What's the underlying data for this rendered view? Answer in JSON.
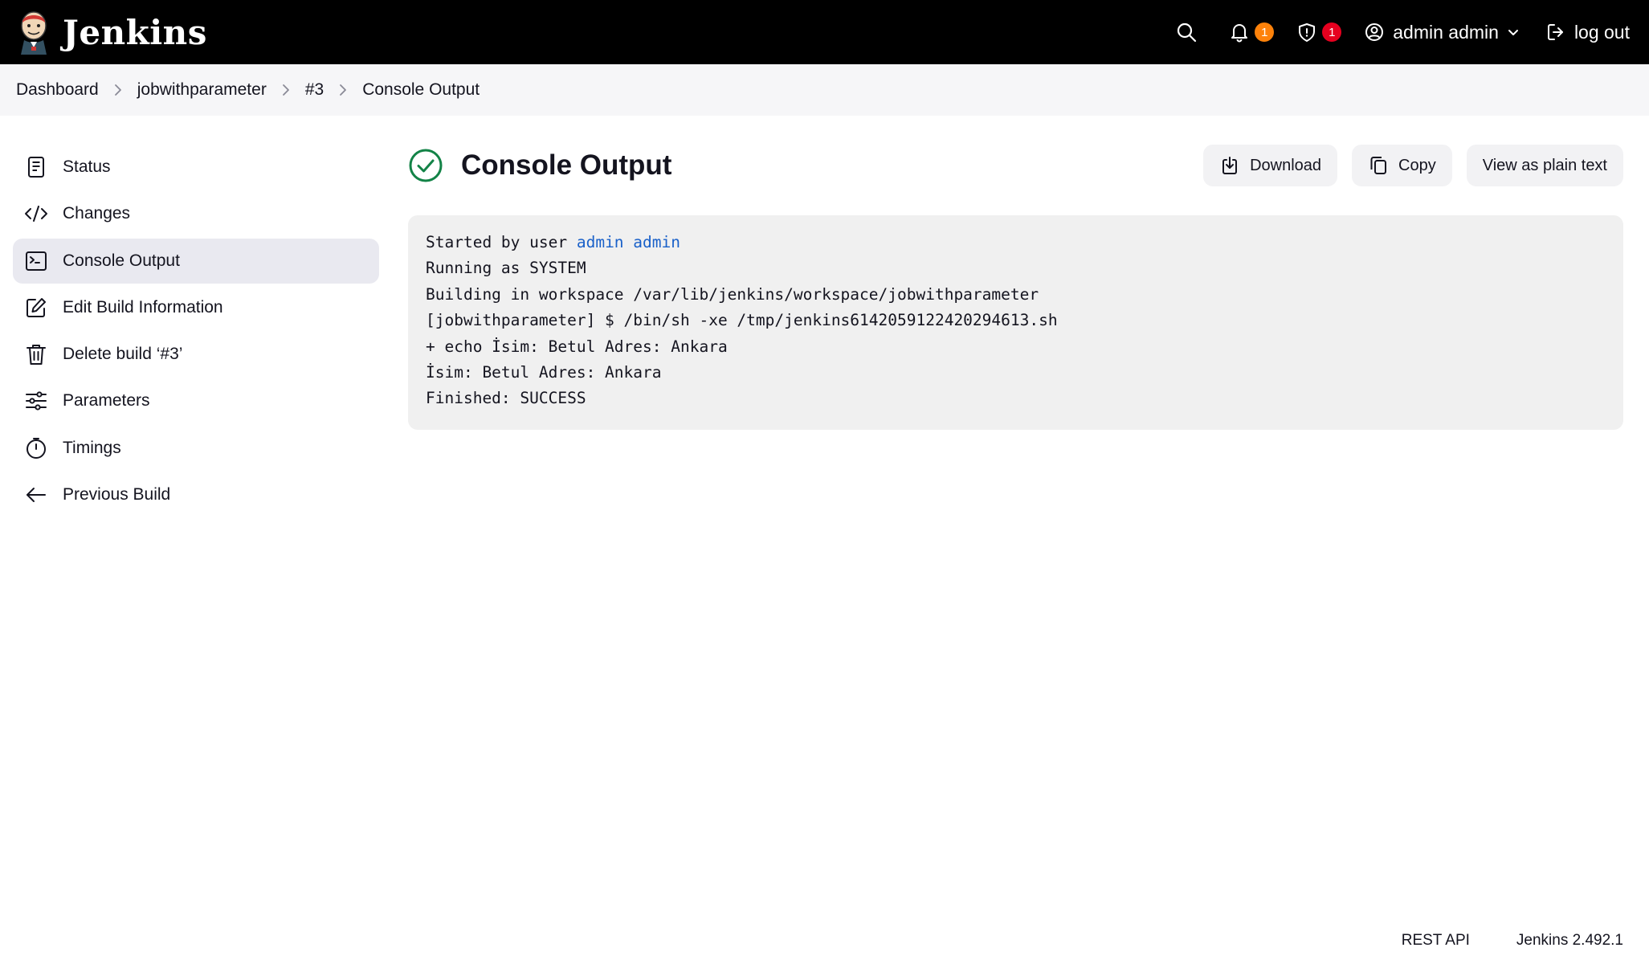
{
  "app": {
    "name": "Jenkins"
  },
  "header": {
    "notifications_count": "1",
    "security_count": "1",
    "user_label": "admin admin",
    "logout_label": "log out"
  },
  "breadcrumb": [
    "Dashboard",
    "jobwithparameter",
    "#3",
    "Console Output"
  ],
  "sidebar": {
    "items": [
      {
        "label": "Status",
        "icon": "document-icon"
      },
      {
        "label": "Changes",
        "icon": "code-icon"
      },
      {
        "label": "Console Output",
        "icon": "terminal-icon",
        "active": true
      },
      {
        "label": "Edit Build Information",
        "icon": "edit-icon"
      },
      {
        "label": "Delete build ‘#3’",
        "icon": "trash-icon"
      },
      {
        "label": "Parameters",
        "icon": "sliders-icon"
      },
      {
        "label": "Timings",
        "icon": "stopwatch-icon"
      },
      {
        "label": "Previous Build",
        "icon": "arrow-left-icon"
      }
    ]
  },
  "main": {
    "title": "Console Output",
    "status": "success",
    "actions": {
      "download": "Download",
      "copy": "Copy",
      "plain_text": "View as plain text"
    },
    "console": {
      "started_prefix": "Started by user ",
      "started_user": "admin admin",
      "lines": [
        "Running as SYSTEM",
        "Building in workspace /var/lib/jenkins/workspace/jobwithparameter",
        "[jobwithparameter] $ /bin/sh -xe /tmp/jenkins6142059122420294613.sh",
        "+ echo İsim: Betul Adres: Ankara",
        "İsim: Betul Adres: Ankara",
        "Finished: SUCCESS"
      ]
    }
  },
  "footer": {
    "rest_api": "REST API",
    "version": "Jenkins 2.492.1"
  },
  "colors": {
    "header_bg": "#000000",
    "badge_orange": "#fe820a",
    "badge_red": "#e6001f",
    "success_green": "#138347",
    "link_blue": "#1a61c9"
  }
}
